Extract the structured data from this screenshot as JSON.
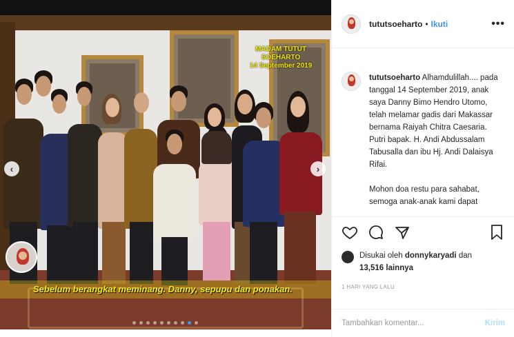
{
  "photo": {
    "watermark_line1": "MADAM TUTUT SOEHARTO",
    "watermark_line2": "14 September 2019",
    "caption": "Sebelum berangkat meminang. Danny, sepupu dan ponakan.",
    "carousel": {
      "count": 10,
      "active_index": 8
    }
  },
  "header": {
    "username": "tututsoeharto",
    "separator": "•",
    "follow_label": "Ikuti",
    "more_label": "•••"
  },
  "post": {
    "author": "tututsoeharto",
    "paragraph1": " Alhamdulillah.... pada tanggal 14 September 2019, anak saya Danny Bimo Hendro Utomo, telah melamar gadis dari Makassar bernama Raiyah Chitra Caesaria. Putri bapak. H. Andi Abdussalam Tabusalla dan ibu Hj. Andi Dalaisya Rifai.",
    "paragraph2": "Mohon doa restu para sahabat, semoga anak-anak kami dapat"
  },
  "likes": {
    "prefix": "Disukai oleh ",
    "user": "donnykaryadi",
    "middle": " dan ",
    "count": "13,516",
    "suffix": " lainnya"
  },
  "time": "1 HARI YANG LALU",
  "comment_box": {
    "placeholder": "Tambahkan komentar...",
    "post_label": "Kirim"
  },
  "colors": {
    "accent": "#3897f0",
    "watermark": "#f2e600",
    "post_disabled": "#b2dffc"
  }
}
